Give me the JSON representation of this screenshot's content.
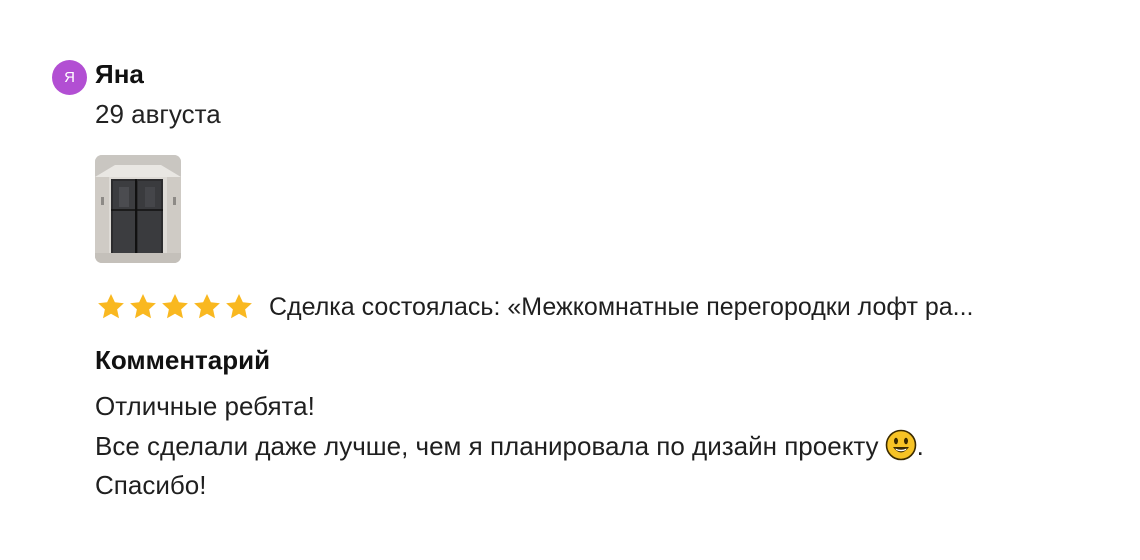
{
  "review": {
    "author": {
      "avatar_letter": "Я",
      "name": "Яна",
      "avatar_color": "#b24fd3"
    },
    "date": "29 августа",
    "photo": {
      "icon": "room-partition-photo"
    },
    "rating": {
      "stars": 5,
      "max": 5,
      "star_color": "#f9b820"
    },
    "deal_text": "Сделка состоялась: «Межкомнатные перегородки лофт ра...",
    "comment": {
      "title": "Комментарий",
      "lines": [
        "Отличные ребята!",
        "Все сделали даже лучше, чем я планировала по дизайн проекту",
        "Спасибо!"
      ],
      "line2_suffix": ".",
      "emoji": "smiley-face-icon"
    }
  }
}
